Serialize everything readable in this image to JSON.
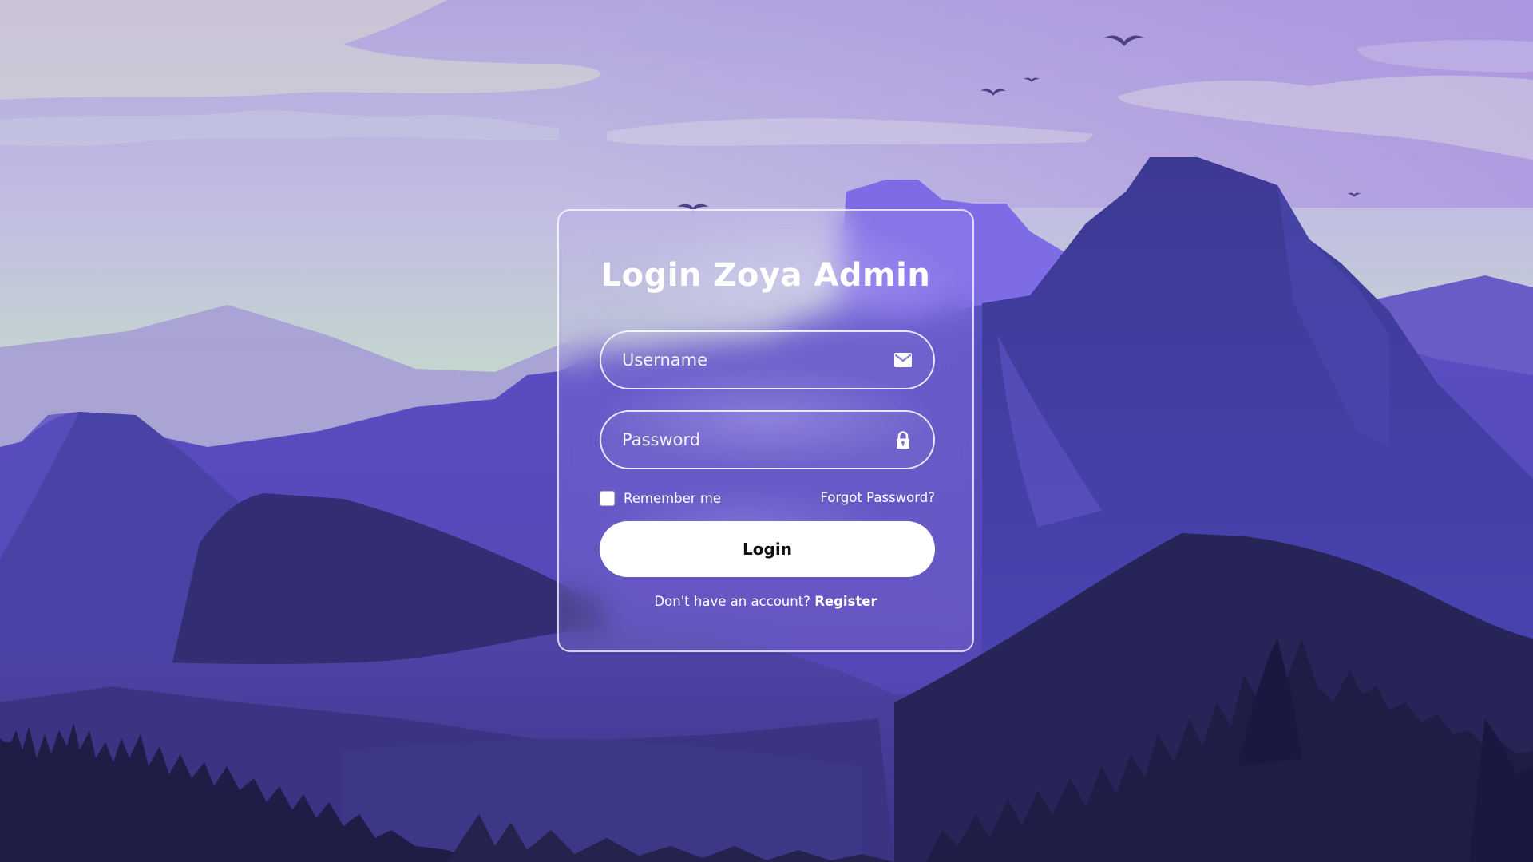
{
  "login": {
    "title": "Login Zoya Admin",
    "username_placeholder": "Username",
    "password_placeholder": "Password",
    "remember_label": "Remember me",
    "remember_checked": false,
    "forgot_label": "Forgot Password?",
    "login_button_label": "Login",
    "register_prompt": "Don't have an account?",
    "register_link_label": "Register"
  },
  "icons": {
    "username": "envelope-icon",
    "password": "lock-icon"
  },
  "colors": {
    "sky_top": "#a898dc",
    "sky_horizon": "#c4dcc0",
    "mountain_light": "#7a6bd6",
    "mountain_mid": "#4e46b0",
    "mountain_dark": "#2e2a66",
    "trees": "#1f1d45",
    "button_bg": "#ffffff",
    "text_on_card": "#ffffff"
  }
}
